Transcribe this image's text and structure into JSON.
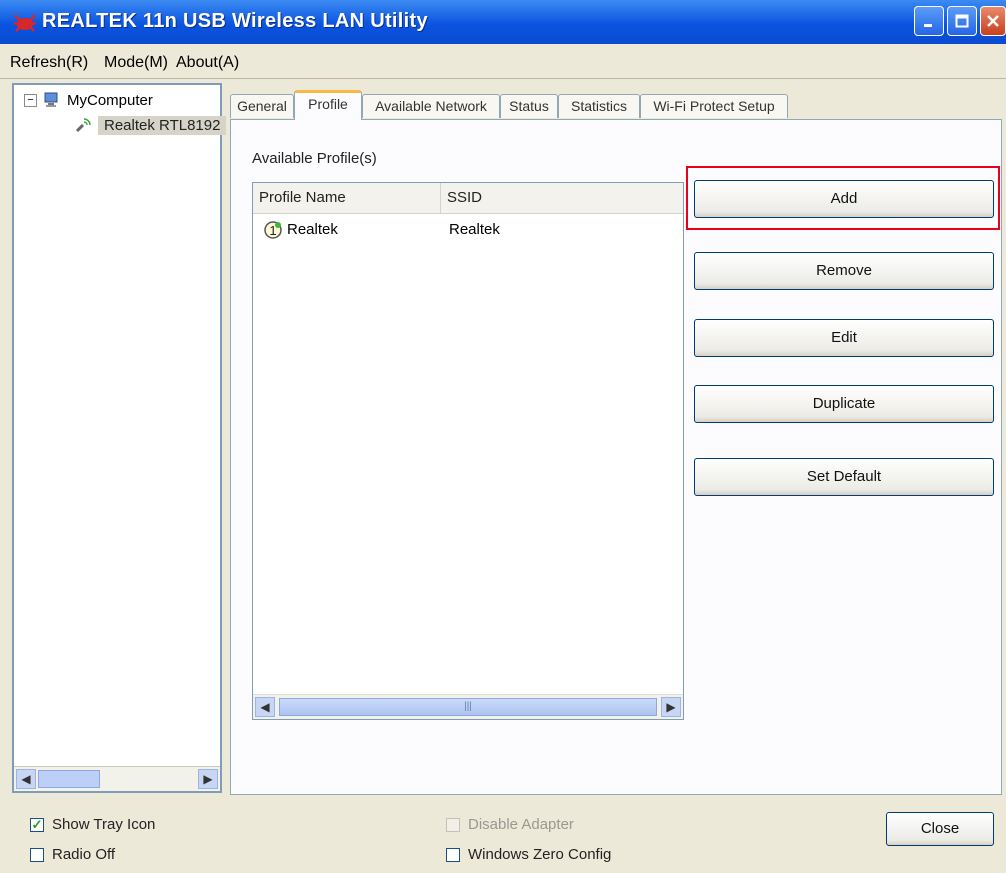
{
  "window": {
    "title": "REALTEK 11n USB Wireless LAN Utility",
    "icon": "realtek-crab-icon"
  },
  "menu": {
    "items": [
      "Refresh(R)",
      "Mode(M)",
      "About(A)"
    ]
  },
  "sidebar": {
    "root_label": "MyComputer",
    "child_label": "Realtek RTL8192"
  },
  "tabs": [
    {
      "label": "General"
    },
    {
      "label": "Profile",
      "active": true
    },
    {
      "label": "Available Network"
    },
    {
      "label": "Status"
    },
    {
      "label": "Statistics"
    },
    {
      "label": "Wi-Fi Protect Setup"
    }
  ],
  "profile": {
    "list_label": "Available Profile(s)",
    "columns": [
      "Profile Name",
      "SSID"
    ],
    "rows": [
      {
        "name": "Realtek",
        "ssid": "Realtek",
        "status_icon": "connected-status-icon"
      }
    ]
  },
  "buttons": {
    "add": "Add",
    "remove": "Remove",
    "edit": "Edit",
    "duplicate": "Duplicate",
    "set_default": "Set Default",
    "close": "Close"
  },
  "options": {
    "show_tray_icon": {
      "label": "Show Tray Icon",
      "checked": true
    },
    "radio_off": {
      "label": "Radio Off",
      "checked": false
    },
    "disable_adapter": {
      "label": "Disable Adapter",
      "checked": false,
      "disabled": true
    },
    "windows_zero_config": {
      "label": "Windows Zero Config",
      "checked": false
    }
  },
  "colors": {
    "titlebar": "#0A54E0",
    "highlight": "#E8001C",
    "active_tab_accent": "#F7B943"
  }
}
